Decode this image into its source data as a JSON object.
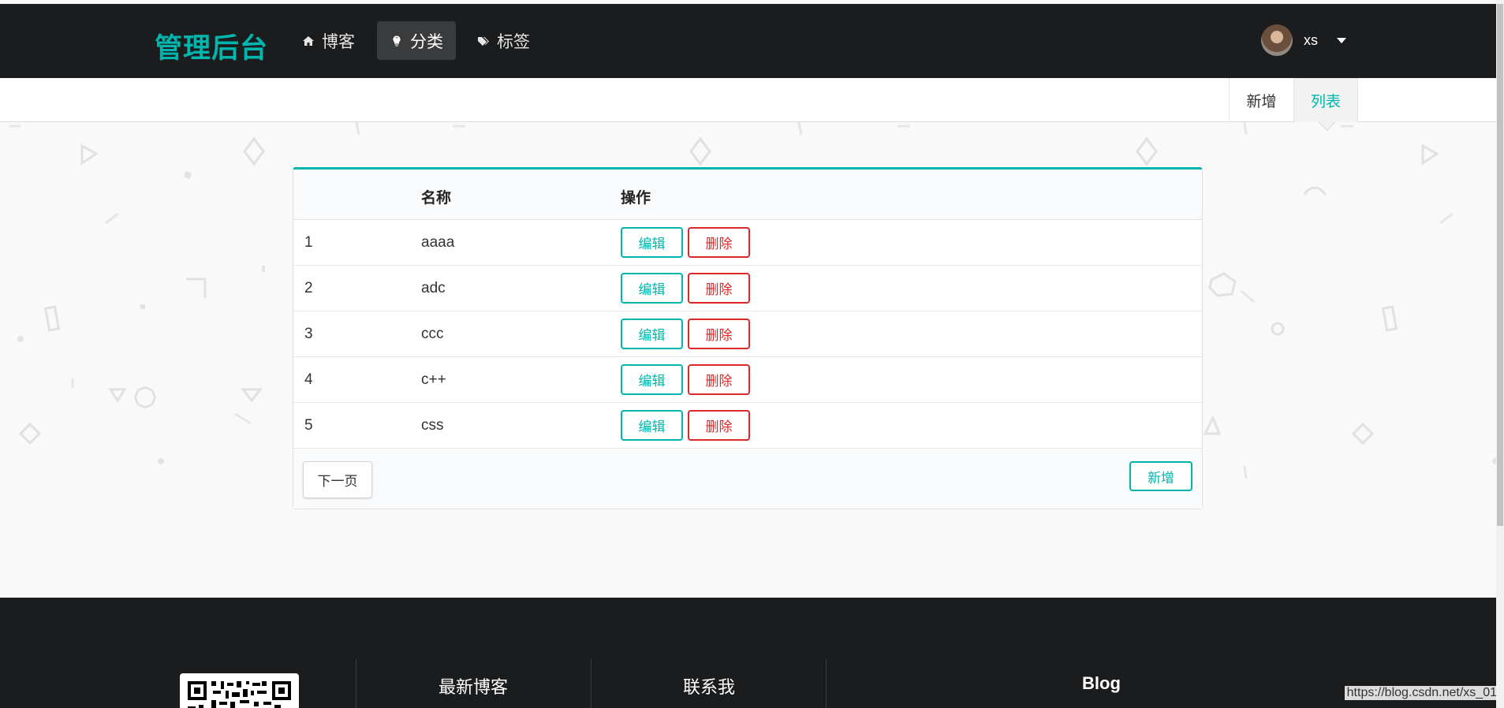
{
  "nav": {
    "brand": "管理后台",
    "items": [
      {
        "label": "博客",
        "icon": "home-icon",
        "active": false
      },
      {
        "label": "分类",
        "icon": "lightbulb-icon",
        "active": true
      },
      {
        "label": "标签",
        "icon": "tags-icon",
        "active": false
      }
    ],
    "user": {
      "name": "xs"
    }
  },
  "subnav": {
    "tabs": [
      {
        "label": "新增",
        "active": false
      },
      {
        "label": "列表",
        "active": true
      }
    ]
  },
  "table": {
    "headers": [
      "",
      "名称",
      "操作"
    ],
    "rows": [
      {
        "id": "1",
        "name": "aaaa"
      },
      {
        "id": "2",
        "name": "adc"
      },
      {
        "id": "3",
        "name": "ccc"
      },
      {
        "id": "4",
        "name": "c++"
      },
      {
        "id": "5",
        "name": "css"
      }
    ],
    "edit_label": "编辑",
    "delete_label": "删除",
    "next_page_label": "下一页",
    "add_label": "新增"
  },
  "footer": {
    "col1": "最新博客",
    "col2": "联系我",
    "col3": "Blog"
  },
  "watermark": "https://blog.csdn.net/xs_01",
  "colors": {
    "accent": "#00b5ad",
    "danger": "#db2828",
    "nav_bg": "#1b1c1d"
  }
}
